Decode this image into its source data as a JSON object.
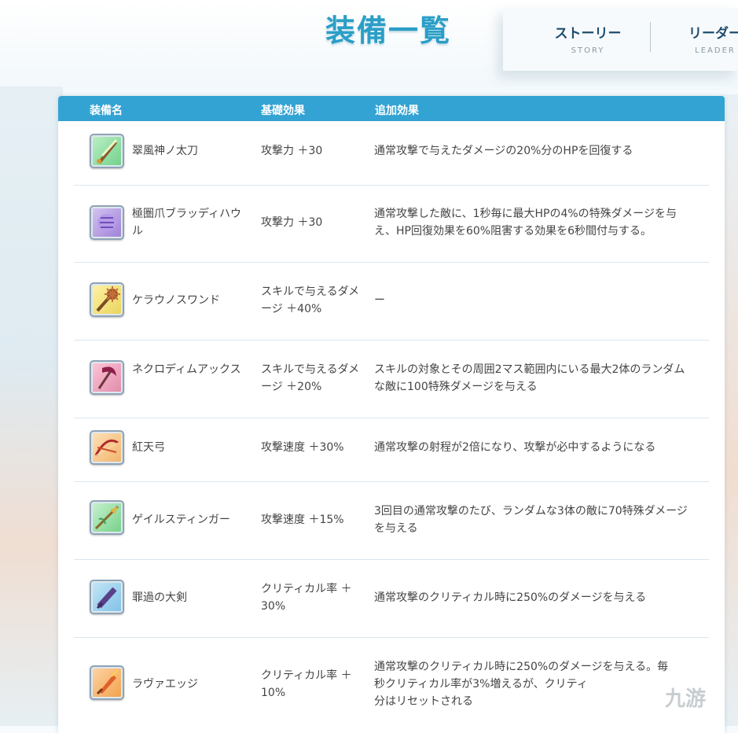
{
  "page": {
    "title": "装備一覧",
    "nav": [
      {
        "label": "ストーリー",
        "sub": "STORY"
      },
      {
        "label": "リーダー",
        "sub": "LEADER"
      }
    ]
  },
  "table": {
    "headers": {
      "name": "装備名",
      "base": "基礎効果",
      "extra": "追加効果"
    },
    "rows": [
      {
        "icon": "green-blade-weapon-icon",
        "name": "翠風神ノ太刀",
        "base": "攻撃力 ＋30",
        "extra": "通常攻撃で与えたダメージの20%分のHPを回復する"
      },
      {
        "icon": "purple-claw-weapon-icon",
        "name": "極圏爪ブラッディハウル",
        "base": "攻撃力 ＋30",
        "extra": "通常攻撃した敵に、1秒毎に最大HPの4%の特殊ダメージを与え、HP回復効果を60%阻害する効果を6秒間付与する。"
      },
      {
        "icon": "spiked-wand-weapon-icon",
        "name": "ケラウノスワンド",
        "base": "スキルで与えるダメージ ＋40%",
        "extra": "ー"
      },
      {
        "icon": "scythe-axe-weapon-icon",
        "name": "ネクロディムアックス",
        "base": "スキルで与えるダメージ ＋20%",
        "extra": "スキルの対象とその周囲2マス範囲内にいる最大2体のランダムな敵に100特殊ダメージを与える"
      },
      {
        "icon": "red-bow-weapon-icon",
        "name": "紅天弓",
        "base": "攻撃速度 ＋30%",
        "extra": "通常攻撃の射程が2倍になり、攻撃が必中するようになる"
      },
      {
        "icon": "lance-weapon-icon",
        "name": "ゲイルスティンガー",
        "base": "攻撃速度 ＋15%",
        "extra": "3回目の通常攻撃のたび、ランダムな3体の敵に70特殊ダメージを与える"
      },
      {
        "icon": "purple-greatsword-weapon-icon",
        "name": "罪過の大剣",
        "base": "クリティカル率 ＋30%",
        "extra": "通常攻撃のクリティカル時に250%のダメージを与える"
      },
      {
        "icon": "orange-blade-weapon-icon",
        "name": "ラヴァエッジ",
        "base": "クリティカル率 ＋10%",
        "extra": "通常攻撃のクリティカル時に250%のダメージを与える。毎秒クリティカル率が3%増えるが、クリティ",
        "extra_tail": "分はリセットされる"
      }
    ]
  },
  "watermark": "九游"
}
